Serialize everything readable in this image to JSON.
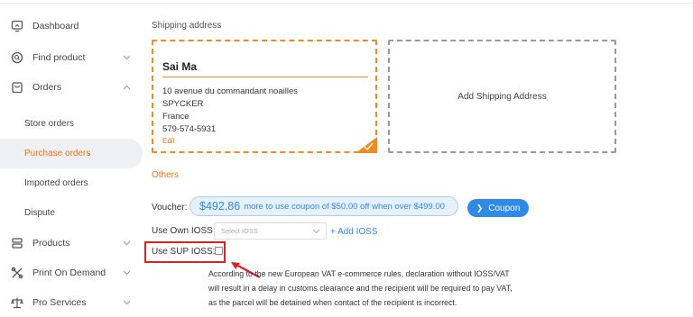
{
  "sidebar": {
    "items": [
      {
        "label": "Dashboard",
        "icon": "monitor-icon"
      },
      {
        "label": "Find product",
        "icon": "search-icon"
      },
      {
        "label": "Orders",
        "icon": "shopping-bag-icon"
      },
      {
        "label": "Products",
        "icon": "layers-icon"
      },
      {
        "label": "Print On Demand",
        "icon": "tools-icon"
      },
      {
        "label": "Pro Services",
        "icon": "balance-scale-icon"
      }
    ],
    "orders_sub": [
      {
        "label": "Store orders"
      },
      {
        "label": "Purchase orders"
      },
      {
        "label": "Imported orders"
      },
      {
        "label": "Dispute"
      }
    ]
  },
  "shipping": {
    "title": "Shipping address",
    "card": {
      "name": "Sai Ma",
      "line1": "10 avenue du commandant noailles",
      "line2": "SPYCKER",
      "line3": "France",
      "phone": "579-574-5931",
      "edit": "Edit"
    },
    "add_label": "Add Shipping Address"
  },
  "others": {
    "title": "Others",
    "voucher_label": "Voucher:",
    "voucher_amount": "$492.86",
    "voucher_text": "more to use coupon of $50.00 off when over $499.00",
    "coupon_button": "Coupon",
    "own_ioss_label": "Use Own IOSS",
    "ioss_placeholder": "Select IOSS",
    "add_ioss": "+ Add IOSS",
    "sup_ioss_label": "Use SUP IOSS:",
    "notice_line1": "According to the new European VAT e-commerce rules, declaration without IOSS/VAT",
    "notice_line2": "will result in a delay in customs clearance and the recipient will be required to pay VAT,",
    "notice_line3": "as the parcel will be detained when contact of the recipient is incorrect."
  },
  "colors": {
    "accent": "#e8760c",
    "link": "#2e8ae6",
    "highlight": "#e02020"
  }
}
